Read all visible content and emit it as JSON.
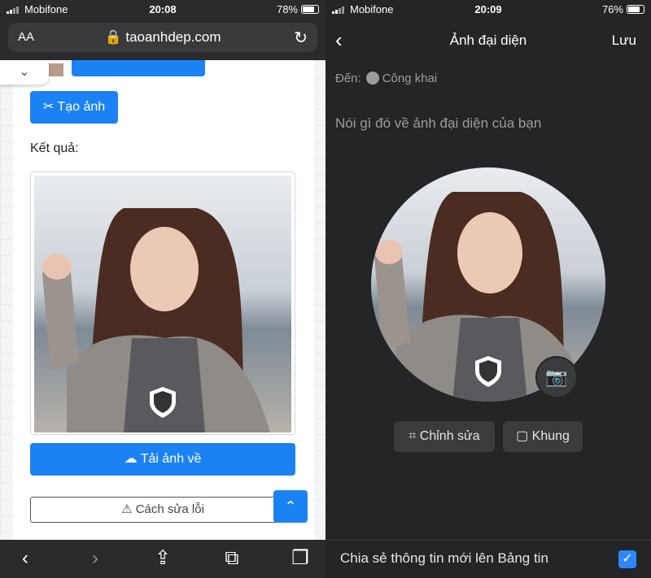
{
  "left": {
    "status": {
      "carrier": "Mobifone",
      "time": "20:08",
      "battery": "78%"
    },
    "browser": {
      "text_size": "AA",
      "url": "taoanhdep.com"
    },
    "buttons": {
      "create": "Tạo ảnh",
      "download": "Tải ảnh về",
      "fix_errors": "Cách sửa lỗi"
    },
    "result_label": "Kết quả:",
    "colors": {
      "primary": "#1b82f3"
    }
  },
  "right": {
    "status": {
      "carrier": "Mobifone",
      "time": "20:09",
      "battery": "76%"
    },
    "nav": {
      "title": "Ảnh đại diện",
      "save": "Lưu"
    },
    "audience": {
      "prefix": "Đến:",
      "value": "Công khai"
    },
    "caption_placeholder": "Nói gì đó về ảnh đại diện của bạn",
    "actions": {
      "edit": "Chỉnh sửa",
      "frame": "Khung"
    },
    "share_toggle": {
      "label": "Chia sẻ thông tin mới lên Bảng tin",
      "checked": true
    },
    "colors": {
      "background": "#242526",
      "accent": "#2d88ff"
    }
  }
}
